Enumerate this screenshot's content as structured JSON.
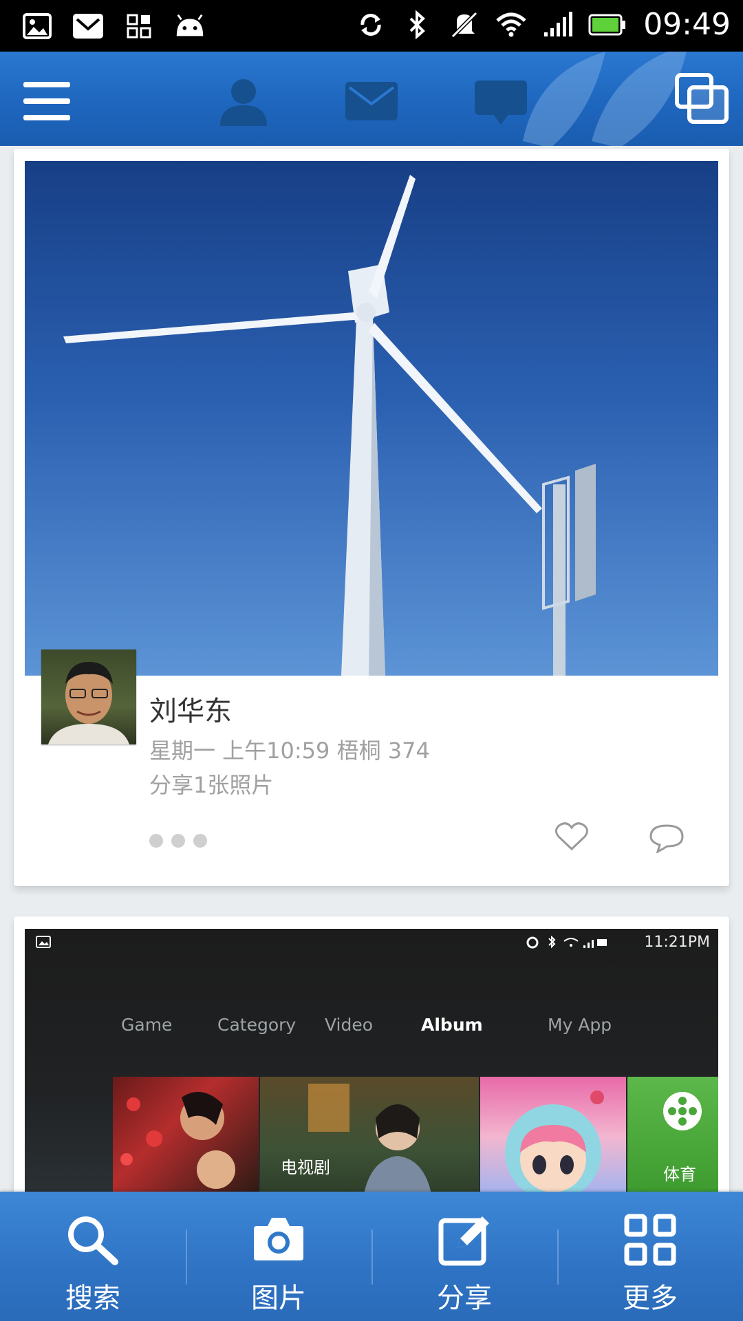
{
  "status_bar": {
    "time": "09:49",
    "left_icons": [
      "image-icon",
      "mail-icon",
      "apps-icon",
      "android-icon"
    ],
    "right_icons": [
      "sync-icon",
      "bluetooth-icon",
      "mute-icon",
      "wifi-icon",
      "signal-icon",
      "battery-icon"
    ]
  },
  "top_bar": {
    "icons": [
      "menu-icon",
      "profile-icon",
      "messages-icon",
      "chat-icon",
      "window-switch-icon"
    ]
  },
  "feed": {
    "post1": {
      "author": "刘华东",
      "meta": "星期一 上午10:59  梧桐 374",
      "caption": "分享1张照片",
      "photo_description": "wind turbine against blue sky"
    },
    "post2": {
      "mini_status_time": "11:21PM",
      "tabs": [
        "Game",
        "Category",
        "Video",
        "Album",
        "My App"
      ],
      "active_tab": "Album",
      "tile_label_drama": "电视剧",
      "tile_label_sports": "体育"
    }
  },
  "bottom_bar": {
    "items": [
      {
        "label": "搜索",
        "icon": "search-icon"
      },
      {
        "label": "图片",
        "icon": "camera-icon"
      },
      {
        "label": "分享",
        "icon": "edit-icon"
      },
      {
        "label": "更多",
        "icon": "grid-icon"
      }
    ]
  },
  "colors": {
    "accent": "#2a78d0",
    "bottom_bar": "#3a82d2",
    "status_bar": "#000000",
    "battery_fill": "#5fd13a"
  }
}
